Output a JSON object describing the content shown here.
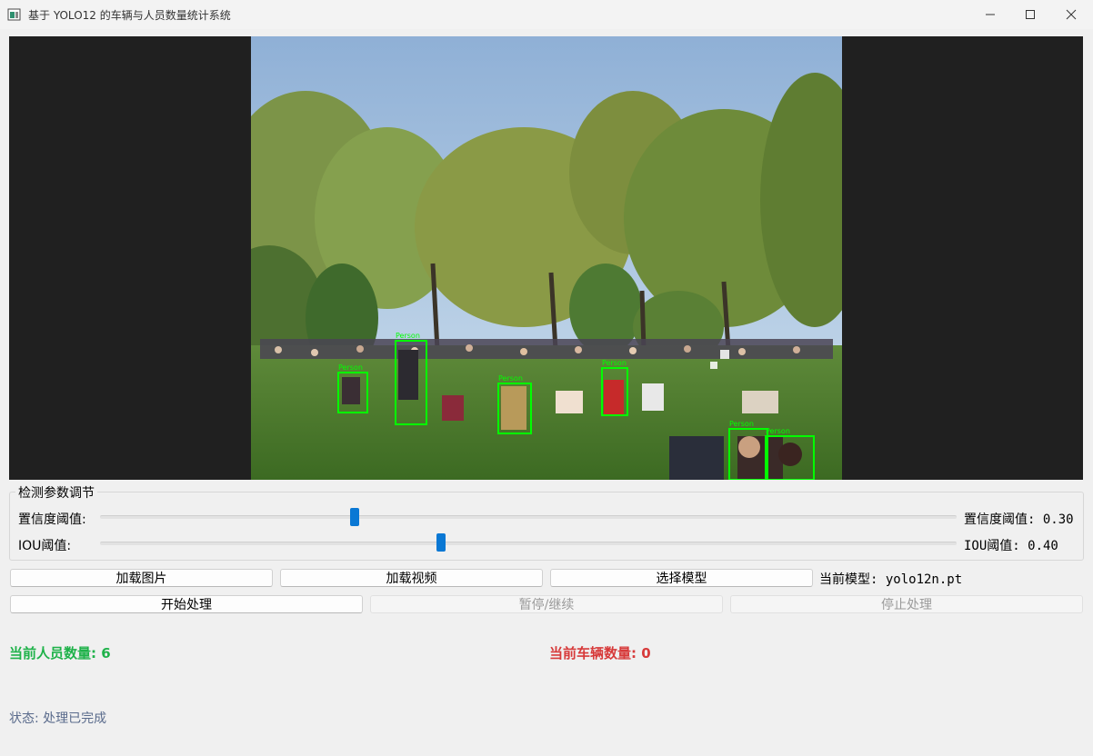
{
  "window": {
    "title": "基于 YOLO12 的车辆与人员数量统计系统"
  },
  "detection": {
    "label": "Person",
    "box_color": "#00ff00"
  },
  "params": {
    "group_title": "检测参数调节",
    "confidence": {
      "label": "置信度阈值:",
      "value_text": "置信度阈值: 0.30",
      "value": 0.3
    },
    "iou": {
      "label": "IOU阈值:",
      "value_text": "IOU阈值: 0.40",
      "value": 0.4
    }
  },
  "buttons": {
    "load_image": "加载图片",
    "load_video": "加载视频",
    "select_model": "选择模型",
    "start": "开始处理",
    "pause": "暂停/继续",
    "stop": "停止处理"
  },
  "model_info": "当前模型: yolo12n.pt",
  "counts": {
    "person": "当前人员数量: 6",
    "vehicle": "当前车辆数量: 0",
    "person_color": "#1fb24a",
    "vehicle_color": "#d73a3a"
  },
  "status": "状态: 处理已完成",
  "accent_color": "#0a78d4"
}
